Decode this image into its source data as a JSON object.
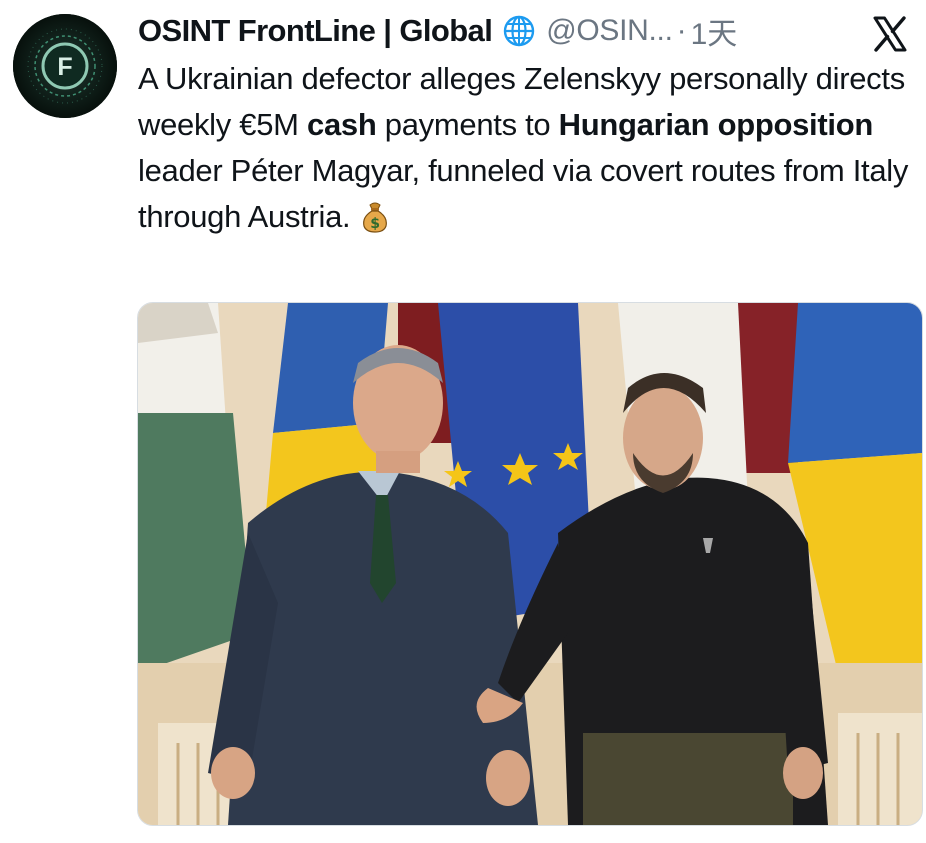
{
  "tweet": {
    "author_name": "OSINT FrontLine | Global",
    "verified_icon": "globe-icon",
    "handle": "@OSIN...",
    "separator": "·",
    "time": "1天",
    "avatar_letter": "F",
    "body": {
      "p1": "A Ukrainian defector alleges Zelenskyy personally directs weekly €5M ",
      "b1": "cash",
      "p2": " payments to ",
      "b2": "Hungarian opposition",
      "p3": " leader Péter Magyar, funneled via covert routes from Italy through Austria.",
      "emoji": "money-bag-icon"
    },
    "media": {
      "type": "photo",
      "description_icon": "photo"
    }
  },
  "colors": {
    "text": "#0f1419",
    "muted": "#6b7682",
    "globe_blue": "#1d9bf0",
    "avatar_bg": "#0b1411",
    "avatar_ring": "#3f8f72"
  },
  "icons": {
    "x_logo": "x-logo-icon"
  }
}
